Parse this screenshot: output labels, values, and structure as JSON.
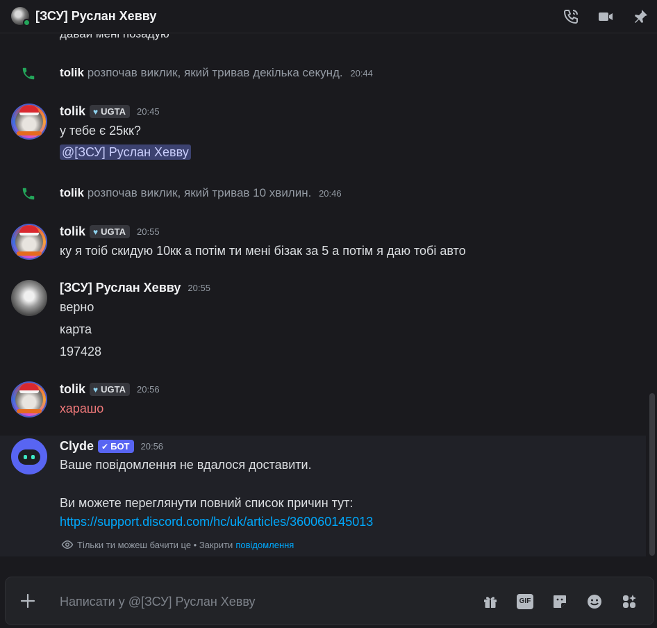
{
  "header": {
    "title": "[ЗСУ] Руслан Хевву",
    "icons": [
      "voice-call-icon",
      "video-call-icon",
      "pin-icon"
    ]
  },
  "messages": {
    "cut_off_text": "давай мені позадую",
    "call_1": {
      "user": "tolik",
      "text": "розпочав виклик, який тривав декілька секунд.",
      "time": "20:44"
    },
    "msg_1": {
      "user": "tolik",
      "role": "UGTA",
      "time": "20:45",
      "lines": [
        "у тебе є 25кк?"
      ],
      "mention": "@[ЗСУ] Руслан Хевву"
    },
    "call_2": {
      "user": "tolik",
      "text": "розпочав виклик, який тривав 10 хвилин.",
      "time": "20:46"
    },
    "msg_2": {
      "user": "tolik",
      "role": "UGTA",
      "time": "20:55",
      "lines": [
        "ку я тоіб скидую 10кк а потім ти мені бізак за 5 а потім я даю тобі авто"
      ]
    },
    "msg_3": {
      "user": "[ЗСУ] Руслан Хевву",
      "time": "20:55",
      "lines": [
        "верно",
        "карта",
        "197428"
      ]
    },
    "msg_4": {
      "user": "tolik",
      "role": "UGTA",
      "time": "20:56",
      "lines": [
        "харашо"
      ]
    },
    "msg_5": {
      "user": "Clyde",
      "bot_tag": "БОТ",
      "time": "20:56",
      "lines": [
        "Ваше повідомлення не вдалося доставити.",
        "Ви можете переглянути повний список причин тут:"
      ],
      "link": "https://support.discord.com/hc/uk/articles/360060145013",
      "ephemeral_text": "Тільки ти можеш бачити це • Закрити",
      "ephemeral_action": "повідомлення"
    }
  },
  "composer": {
    "placeholder": "Написати у @[ЗСУ] Руслан Хевву",
    "gif_label": "GIF",
    "tools": [
      "gift-icon",
      "gif-icon",
      "sticker-icon",
      "emoji-icon",
      "apps-icon"
    ]
  },
  "colors": {
    "background": "#1a1a1e",
    "call_green": "#23a55a",
    "link_blue": "#00a8fc",
    "bot_blurple": "#5865f2",
    "error_red": "#f0797a"
  }
}
